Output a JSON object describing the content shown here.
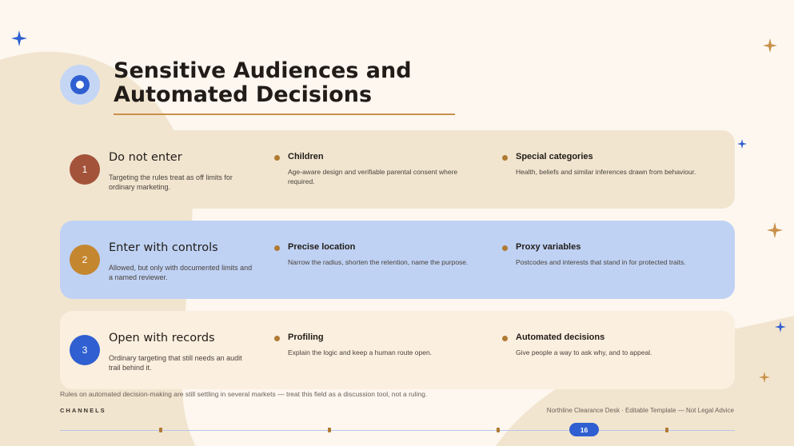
{
  "title": "Sensitive Audiences and Automated Decisions",
  "tiers": [
    {
      "number": "1",
      "title": "Do not enter",
      "description": "Targeting the rules treat as off limits for ordinary marketing.",
      "items": [
        {
          "title": "Children",
          "description": "Age-aware design and verifiable parental consent where required."
        },
        {
          "title": "Special categories",
          "description": "Health, beliefs and similar inferences drawn from behaviour."
        }
      ]
    },
    {
      "number": "2",
      "title": "Enter with controls",
      "description": "Allowed, but only with documented limits and a named reviewer.",
      "items": [
        {
          "title": "Precise location",
          "description": "Narrow the radius, shorten the retention, name the purpose."
        },
        {
          "title": "Proxy variables",
          "description": "Postcodes and interests that stand in for protected traits."
        }
      ]
    },
    {
      "number": "3",
      "title": "Open with records",
      "description": "Ordinary targeting that still needs an audit trail behind it.",
      "items": [
        {
          "title": "Profiling",
          "description": "Explain the logic and keep a human route open."
        },
        {
          "title": "Automated decisions",
          "description": "Give people a way to ask why, and to appeal."
        }
      ]
    }
  ],
  "footnote": "Rules on automated decision-making are still settling in several markets — treat this field as a discussion tool, not a ruling.",
  "footer": {
    "section": "CHANNELS",
    "brand": "Northline Clearance Desk · Editable Template — Not Legal Advice",
    "page_number": "16"
  },
  "colors": {
    "background": "#fdf7f0",
    "accent_blue": "#2f5fd0",
    "accent_gold": "#c9914a",
    "tier1_badge": "#a4533b",
    "tier2_badge": "#c4862f",
    "tier3_badge": "#2f5fd0"
  },
  "icons": [
    "target-icon",
    "sparkle-icon"
  ]
}
